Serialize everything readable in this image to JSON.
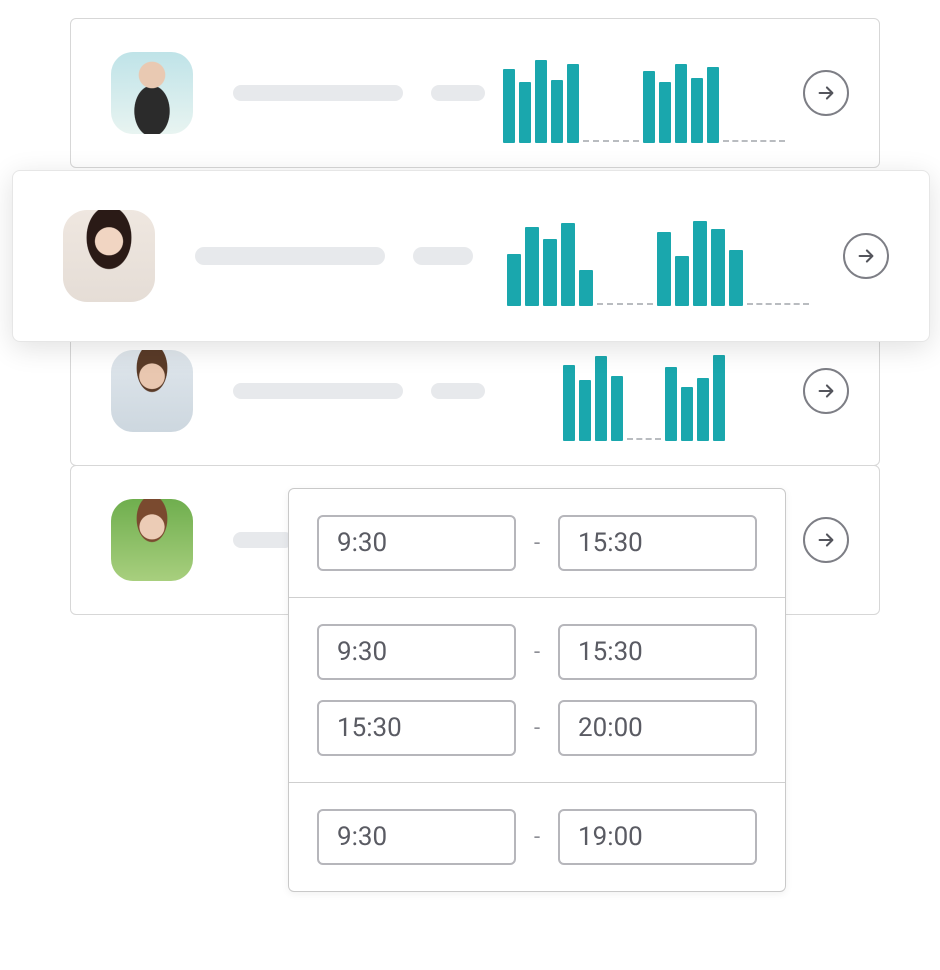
{
  "colors": {
    "bar": "#1aa7ad",
    "border": "#c9c9c9",
    "text": "#5a5b63"
  },
  "rows": [
    {
      "id": "user-1",
      "avatar": "av-1"
    },
    {
      "id": "user-2",
      "avatar": "av-2"
    },
    {
      "id": "user-3",
      "avatar": "av-3"
    },
    {
      "id": "user-4",
      "avatar": "av-4"
    }
  ],
  "chart_data": [
    {
      "type": "bar",
      "row": "user-1",
      "group1": [
        82,
        68,
        92,
        70,
        88
      ],
      "group2": [
        80,
        68,
        88,
        72,
        84
      ],
      "ylim": [
        0,
        100
      ]
    },
    {
      "type": "bar",
      "row": "user-2",
      "group1": [
        58,
        88,
        74,
        92,
        40
      ],
      "group2": [
        82,
        56,
        94,
        86,
        62
      ],
      "ylim": [
        0,
        100
      ]
    },
    {
      "type": "bar",
      "row": "user-3",
      "group1": [
        84,
        68,
        94,
        72
      ],
      "group2": [
        82,
        60,
        70,
        96
      ],
      "ylim": [
        0,
        100
      ]
    }
  ],
  "time_popup": {
    "sections": [
      {
        "ranges": [
          {
            "start": "9:30",
            "end": "15:30"
          }
        ]
      },
      {
        "ranges": [
          {
            "start": "9:30",
            "end": "15:30"
          },
          {
            "start": "15:30",
            "end": "20:00"
          }
        ]
      },
      {
        "ranges": [
          {
            "start": "9:30",
            "end": "19:00"
          }
        ]
      }
    ],
    "separator": "-"
  }
}
